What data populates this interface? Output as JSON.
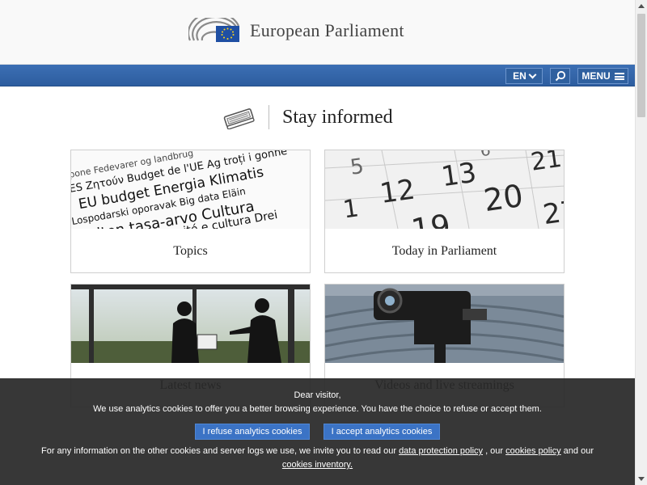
{
  "header": {
    "site_title": "European Parliament",
    "logo_icon": "ep-hemicycle-logo-icon",
    "eu_flag_colors": {
      "blue": "#1f4fa3",
      "stars": "#ffd617"
    }
  },
  "nav": {
    "language": "EN",
    "search_icon": "search-icon",
    "menu_label": "MENU",
    "bar_color": "#3564a8"
  },
  "section": {
    "icon": "newspaper-icon",
    "title": "Stay informed"
  },
  "cards": [
    {
      "label": "Topics",
      "image": "words-collage"
    },
    {
      "label": "Today in Parliament",
      "image": "calendar-closeup"
    },
    {
      "label": "Latest news",
      "image": "interview-silhouettes"
    },
    {
      "label": "Videos and live streamings",
      "image": "camera-hemicycle"
    }
  ],
  "cookie_banner": {
    "greeting": "Dear visitor,",
    "message": "We use analytics cookies to offer you a better browsing experience. You have the choice to refuse or accept them.",
    "refuse_label": "I refuse analytics cookies",
    "accept_label": "I accept analytics cookies",
    "info_prefix": "For any information on the other cookies and server logs we use, we invite you to read our",
    "link_protection": "data protection policy",
    "comma": " , our ",
    "link_cookies_policy": "cookies policy",
    "and_our": " and our ",
    "link_inventory": "cookies inventory.",
    "button_color": "#3b73c5"
  }
}
